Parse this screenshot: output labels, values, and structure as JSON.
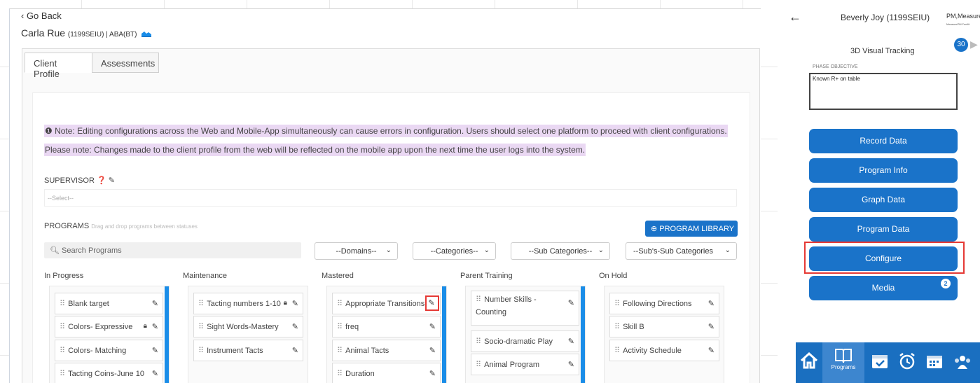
{
  "web": {
    "go_back": "‹ Go Back",
    "client_name": "Carla Rue",
    "client_meta": "(1199SEIU) | ABA(BT)",
    "tabs": [
      "Client Profile",
      "Assessments"
    ],
    "note1": "Note: Editing configurations across the Web and Mobile-App simultaneously can cause errors in configuration. Users should select one platform to proceed with client configurations.",
    "note2": "Please note: Changes made to the client profile from the web will be reflected on the mobile app upon the next time the user logs into the system.",
    "supervisor_label": "SUPERVISOR",
    "supervisor_placeholder": "--Select--",
    "programs_label": "PROGRAMS",
    "programs_hint": "Drag and drop programs between statuses",
    "program_library": "PROGRAM LIBRARY",
    "search_placeholder": "Search Programs",
    "filters": [
      "--Domains--",
      "--Categories--",
      "--Sub Categories--",
      "--Sub's-Sub Categories"
    ],
    "columns": [
      {
        "title": "In Progress",
        "items": [
          "Blank target",
          "Colors- Expressive",
          "Colors- Matching",
          "Tacting Coins-June 10"
        ]
      },
      {
        "title": "Maintenance",
        "items": [
          "Tacting numbers 1-10",
          "Sight Words-Mastery",
          "Instrument Tacts"
        ]
      },
      {
        "title": "Mastered",
        "items": [
          "Appropriate Transitions",
          "freq",
          "Animal Tacts",
          "Duration"
        ]
      },
      {
        "title": "Parent Training",
        "items": [
          "Number Skills - Counting",
          "Socio-dramatic Play",
          "Animal Program"
        ]
      },
      {
        "title": "On Hold",
        "items": [
          "Following Directions",
          "Skill B",
          "Activity Schedule"
        ]
      }
    ]
  },
  "mobile": {
    "client": "Beverly Joy (1199SEIU)",
    "pm": "PM,Measure",
    "pm_sub": "MeasurePM Facilit",
    "badge": "30",
    "program_title": "3D Visual Tracking",
    "phase_label": "PHASE OBJECTIVE",
    "phase_text": "Known R+ on table",
    "buttons": [
      "Record Data",
      "Program Info",
      "Graph Data",
      "Program Data",
      "Configure",
      "Media"
    ],
    "media_count": "2",
    "nav_programs": "Programs"
  },
  "colors": {
    "accent": "#1a73c9",
    "highlight": "#ead8f3",
    "callout": "#e53935"
  }
}
